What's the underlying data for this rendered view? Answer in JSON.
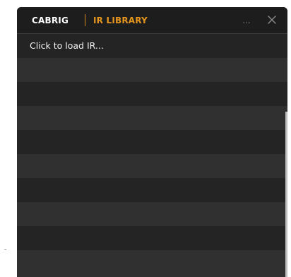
{
  "panel": {
    "tabs": [
      {
        "label": "CABRIG",
        "active": false
      },
      {
        "label": "IR LIBRARY",
        "active": true
      }
    ],
    "more_label": "...",
    "close_label": "close",
    "accent_color": "#e5961f"
  },
  "list": {
    "first_row_label": "Click to load IR...",
    "row_count": 10
  }
}
